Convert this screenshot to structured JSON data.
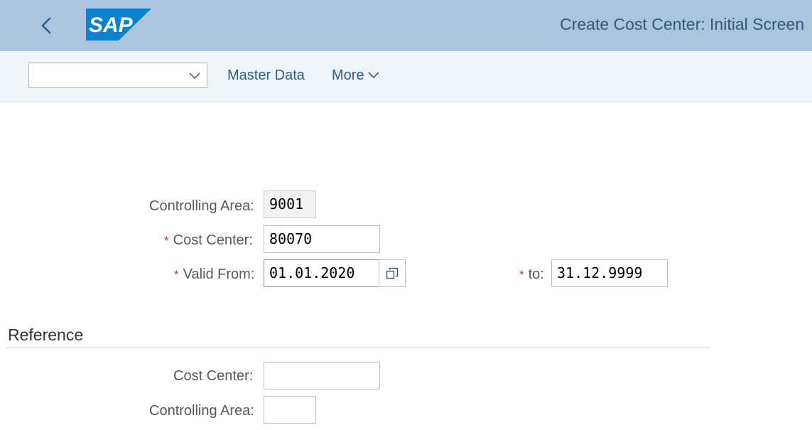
{
  "shell": {
    "title": "Create Cost Center: Initial Screen",
    "logo_text": "SAP",
    "brand_color": "#0a82d0",
    "back_icon": "chevron-left-icon"
  },
  "toolbar": {
    "command_field_value": "",
    "master_data_label": "Master Data",
    "more_label": "More"
  },
  "form": {
    "controlling_area_label": "Controlling Area:",
    "controlling_area_value": "9001",
    "cost_center_label": "Cost Center:",
    "cost_center_value": "80070",
    "valid_from_label": "Valid From:",
    "valid_from_value": "01.01.2020",
    "valid_to_label": "to:",
    "valid_to_value": "31.12.9999",
    "required_marker": "*"
  },
  "reference": {
    "title": "Reference",
    "cost_center_label": "Cost Center:",
    "cost_center_value": "",
    "controlling_area_label": "Controlling Area:",
    "controlling_area_value": ""
  }
}
